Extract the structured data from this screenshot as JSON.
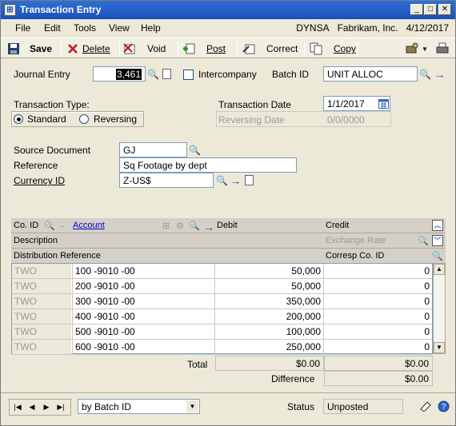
{
  "window": {
    "title": "Transaction Entry"
  },
  "menu": {
    "items": [
      "File",
      "Edit",
      "Tools",
      "View",
      "Help"
    ],
    "company_code": "DYNSA",
    "company_name": "Fabrikam, Inc.",
    "date": "4/12/2017"
  },
  "toolbar": {
    "save": "Save",
    "delete": "Delete",
    "void": "Void",
    "post": "Post",
    "correct": "Correct",
    "copy": "Copy"
  },
  "form": {
    "journal_entry_label": "Journal Entry",
    "journal_entry_value": "3,461",
    "intercompany_label": "Intercompany",
    "batch_id_label": "Batch ID",
    "batch_id_value": "UNIT ALLOC",
    "transaction_type_label": "Transaction Type:",
    "standard_label": "Standard",
    "reversing_label": "Reversing",
    "transaction_date_label": "Transaction Date",
    "transaction_date_value": "1/1/2017",
    "reversing_date_label": "Reversing Date",
    "reversing_date_value": "0/0/0000",
    "source_document_label": "Source Document",
    "source_document_value": "GJ",
    "reference_label": "Reference",
    "reference_value": "Sq Footage by dept",
    "currency_id_label": "Currency ID",
    "currency_id_value": "Z-US$"
  },
  "grid": {
    "headers": {
      "co_id": "Co. ID",
      "account": "Account",
      "debit": "Debit",
      "credit": "Credit",
      "description": "Description",
      "exchange_rate": "Exchange Rate",
      "distribution_reference": "Distribution Reference",
      "corresp_co_id": "Corresp Co. ID"
    },
    "rows": [
      {
        "co": "TWO",
        "account": "100 -9010 -00",
        "debit": "50,000",
        "credit": "0"
      },
      {
        "co": "TWO",
        "account": "200 -9010 -00",
        "debit": "50,000",
        "credit": "0"
      },
      {
        "co": "TWO",
        "account": "300 -9010 -00",
        "debit": "350,000",
        "credit": "0"
      },
      {
        "co": "TWO",
        "account": "400 -9010 -00",
        "debit": "200,000",
        "credit": "0"
      },
      {
        "co": "TWO",
        "account": "500 -9010 -00",
        "debit": "100,000",
        "credit": "0"
      },
      {
        "co": "TWO",
        "account": "600 -9010 -00",
        "debit": "250,000",
        "credit": "0"
      }
    ],
    "total_label": "Total",
    "total_debit": "$0.00",
    "total_credit": "$0.00",
    "difference_label": "Difference",
    "difference_value": "$0.00"
  },
  "footer": {
    "sort_value": "by Batch ID",
    "status_label": "Status",
    "status_value": "Unposted"
  }
}
